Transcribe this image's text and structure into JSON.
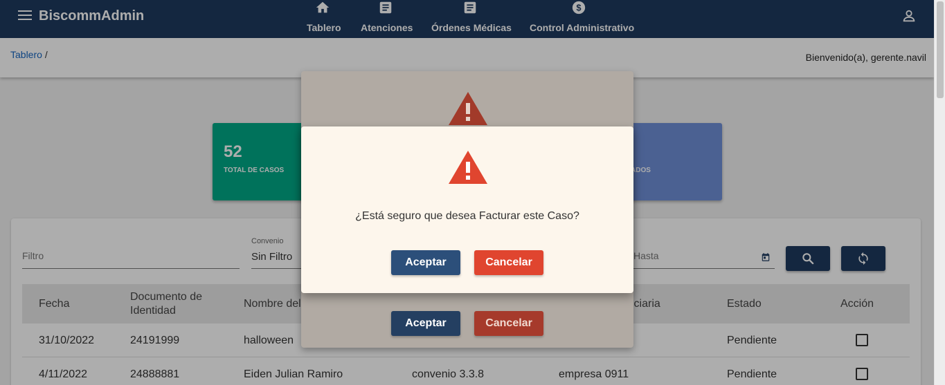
{
  "header": {
    "brand": "BiscommAdmin",
    "nav": [
      {
        "label": "Tablero",
        "icon": "home-icon"
      },
      {
        "label": "Atenciones",
        "icon": "document-icon"
      },
      {
        "label": "Órdenes Médicas",
        "icon": "document-icon"
      },
      {
        "label": "Control Administrativo",
        "icon": "dollar-circle-icon"
      }
    ]
  },
  "breadcrumb": {
    "root": "Tablero",
    "separator": "/"
  },
  "welcome": "Bienvenido(a), gerente.navil",
  "cards": [
    {
      "value": "52",
      "label": "TOTAL DE CASOS",
      "color": "#00a887"
    },
    {
      "value": "",
      "label": "ADOS",
      "color": "#6f8fd8"
    }
  ],
  "filters": {
    "filtro_placeholder": "Filtro",
    "convenio_label": "Convenio",
    "convenio_value": "Sin Filtro",
    "hasta_placeholder": "Hasta"
  },
  "table": {
    "headers": [
      "Fecha",
      "Documento de Identidad",
      "Nombre del",
      "iciaria",
      "Estado",
      "Acción"
    ],
    "rows": [
      {
        "fecha": "31/10/2022",
        "documento": "24191999",
        "nombre": "halloween",
        "convenio": "",
        "beneficiaria": "",
        "estado": "Pendiente"
      },
      {
        "fecha": "4/11/2022",
        "documento": "24888881",
        "nombre": "Eiden Julian Ramiro",
        "convenio": "convenio 3.3.8",
        "beneficiaria": "empresa 0911",
        "estado": "Pendiente"
      }
    ]
  },
  "dialog": {
    "message": "¿Está seguro que desea Facturar este Caso?",
    "accept": "Aceptar",
    "cancel": "Cancelar"
  },
  "colors": {
    "topbar": "#1e3a5f",
    "accept": "#2c4f7a",
    "cancel": "#e0452f",
    "warning": "#e0452f"
  }
}
